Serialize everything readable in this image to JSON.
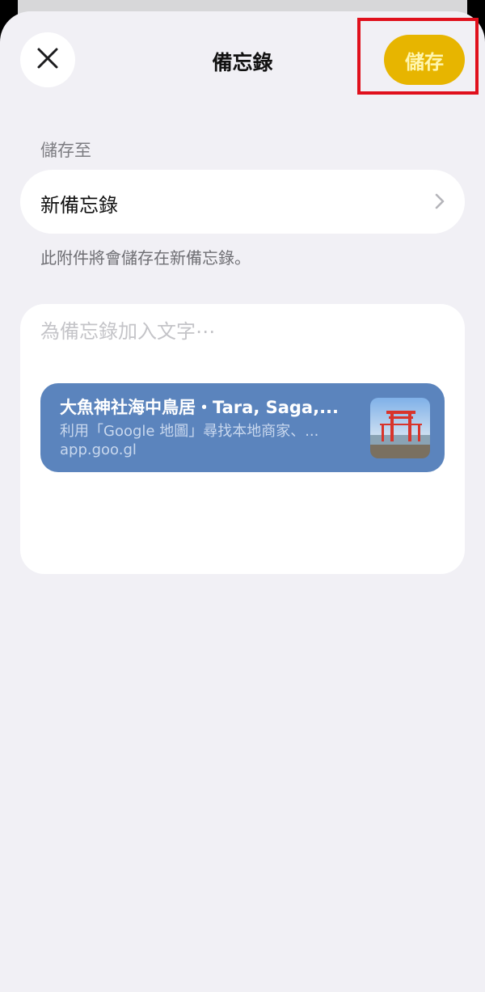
{
  "header": {
    "title": "備忘錄",
    "save_label": "儲存"
  },
  "destination": {
    "section_label": "儲存至",
    "selected": "新備忘錄",
    "hint": "此附件將會儲存在新備忘錄。"
  },
  "note": {
    "placeholder": "為備忘錄加入文字⋯",
    "link": {
      "title": "大魚神社海中鳥居・Tara, Saga,...",
      "description": "利用「Google 地圖」尋找本地商家、...",
      "url": "app.goo.gl"
    }
  },
  "colors": {
    "accent": "#e7b500",
    "sheet_background": "#f1f0f5",
    "link_card": "#5b84bd",
    "highlight": "#e0101c"
  },
  "icons": [
    "close-icon",
    "chevron-right-icon"
  ]
}
